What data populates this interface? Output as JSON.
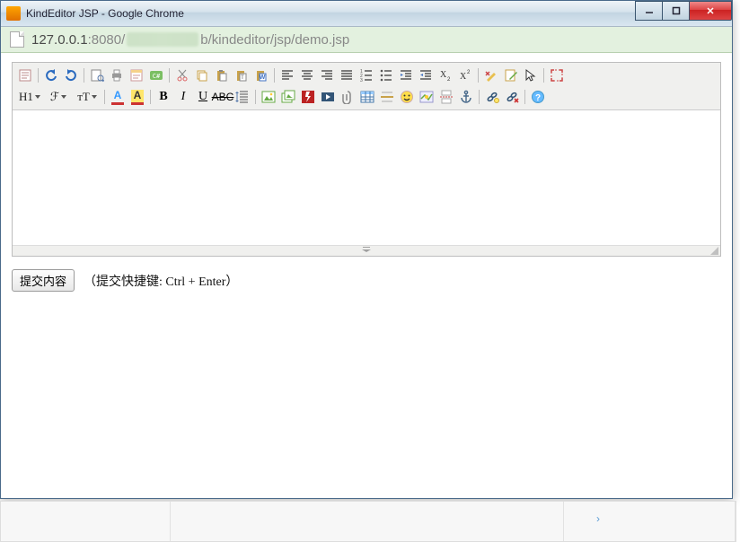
{
  "window": {
    "title": "KindEditor JSP - Google Chrome"
  },
  "address": {
    "host": "127.0.0.1",
    "port": ":8080",
    "path_prefix": "/",
    "path_suffix": "b/kindeditor/jsp/demo.jsp"
  },
  "toolbar": {
    "row1": [
      {
        "name": "source-icon"
      },
      {
        "sep": true
      },
      {
        "name": "undo-icon"
      },
      {
        "name": "redo-icon"
      },
      {
        "sep": true
      },
      {
        "name": "preview-icon"
      },
      {
        "name": "print-icon"
      },
      {
        "name": "template-icon"
      },
      {
        "name": "code-icon"
      },
      {
        "sep": true
      },
      {
        "name": "cut-icon"
      },
      {
        "name": "copy-icon"
      },
      {
        "name": "paste-icon"
      },
      {
        "name": "plainpaste-icon"
      },
      {
        "name": "wordpaste-icon"
      },
      {
        "sep": true
      },
      {
        "name": "justifyleft-icon"
      },
      {
        "name": "justifycenter-icon"
      },
      {
        "name": "justifyright-icon"
      },
      {
        "name": "justifyfull-icon"
      },
      {
        "name": "insertorderedlist-icon"
      },
      {
        "name": "insertunorderedlist-icon"
      },
      {
        "name": "indent-icon"
      },
      {
        "name": "outdent-icon"
      },
      {
        "name": "subscript-icon"
      },
      {
        "name": "superscript-icon"
      },
      {
        "sep": true
      },
      {
        "name": "removeformat-icon"
      },
      {
        "name": "quickformat-icon"
      },
      {
        "name": "selectall-icon"
      },
      {
        "sep": true
      },
      {
        "name": "fullscreen-icon"
      }
    ],
    "row2": [
      {
        "name": "formatblock-icon",
        "wide": true,
        "label": "H1"
      },
      {
        "name": "fontname-icon",
        "wide": true,
        "label": "ℱ"
      },
      {
        "name": "fontsize-icon",
        "wide": true,
        "label": "тT"
      },
      {
        "sep": true
      },
      {
        "name": "forecolor-icon"
      },
      {
        "name": "hilitecolor-icon"
      },
      {
        "sep": true
      },
      {
        "name": "bold-icon"
      },
      {
        "name": "italic-icon"
      },
      {
        "name": "underline-icon"
      },
      {
        "name": "strikethrough-icon"
      },
      {
        "name": "lineheight-icon"
      },
      {
        "sep": true
      },
      {
        "name": "image-icon"
      },
      {
        "name": "multiimage-icon"
      },
      {
        "name": "flash-icon"
      },
      {
        "name": "media-icon"
      },
      {
        "name": "insertfile-icon"
      },
      {
        "name": "table-icon"
      },
      {
        "name": "hr-icon"
      },
      {
        "name": "emoticons-icon"
      },
      {
        "name": "baidumap-icon"
      },
      {
        "name": "pagebreak-icon"
      },
      {
        "name": "anchor-icon"
      },
      {
        "sep": true
      },
      {
        "name": "link-icon"
      },
      {
        "name": "unlink-icon"
      },
      {
        "sep": true
      },
      {
        "name": "about-icon"
      }
    ]
  },
  "form": {
    "submit_label": "提交内容",
    "hint_text": "（提交快捷键: Ctrl + Enter）"
  }
}
